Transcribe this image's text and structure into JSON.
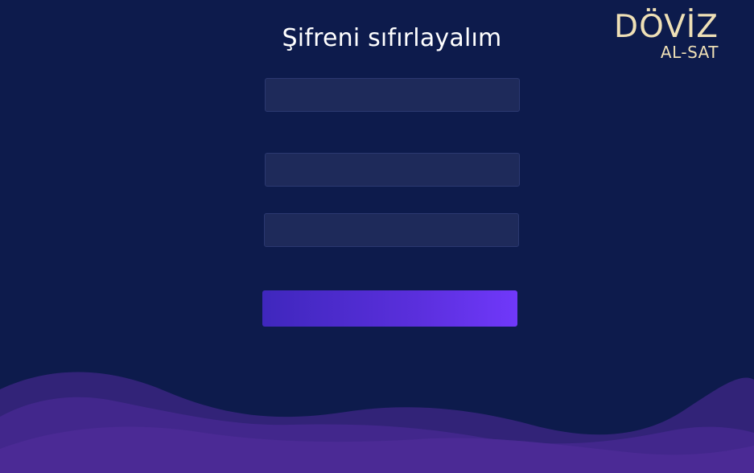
{
  "header": {
    "title": "Şifreni sıfırlayalım"
  },
  "logo": {
    "main": "DÖVİZ",
    "sub": "AL-SAT"
  },
  "form": {
    "field_1_value": "",
    "field_2_value": "",
    "field_3_value": "",
    "submit_label": ""
  },
  "colors": {
    "background": "#0d1b4c",
    "field_background": "#1e2a5a",
    "button_gradient_start": "#3f27bd",
    "button_gradient_end": "#7038fa",
    "logo_color": "#efe0b6",
    "wave_color": "#4a2a8f"
  }
}
